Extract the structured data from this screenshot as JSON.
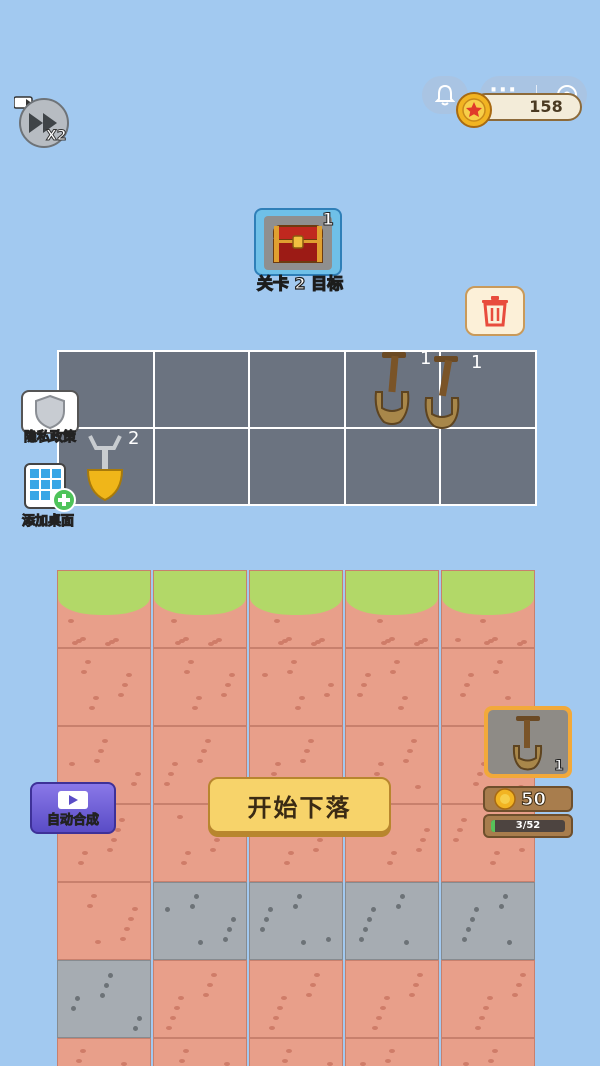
{
  "header": {
    "coins": "158",
    "speed_label": "X2"
  },
  "goal": {
    "chest_count": "1",
    "label": "关卡 2 目标"
  },
  "merge_grid": {
    "items": [
      {
        "row": 0,
        "col": 3,
        "item": "bronze-shovel",
        "count": "1"
      },
      {
        "row": 0,
        "col": 4,
        "item": "bronze-shovel",
        "count": "1"
      },
      {
        "row": 1,
        "col": 0,
        "item": "gold-shovel",
        "count": "2"
      }
    ]
  },
  "side_buttons": {
    "privacy": "隐私政策",
    "add_desktop": "添加桌面",
    "auto_merge": "自动合成"
  },
  "actions": {
    "start_drop": "开始下落"
  },
  "shop": {
    "shovel_count": "1",
    "price": "50",
    "progress_text": "3/52",
    "progress_value": 0.0577
  },
  "terrain": {
    "columns": [
      [
        "grass",
        "dirt",
        "dirt",
        "dirt",
        "dirt",
        "stone",
        "dirt"
      ],
      [
        "grass",
        "dirt",
        "dirt",
        "dirt",
        "stone",
        "dirt",
        "dirt"
      ],
      [
        "grass",
        "dirt",
        "dirt",
        "dirt",
        "stone",
        "dirt",
        "dirt"
      ],
      [
        "grass",
        "dirt",
        "dirt",
        "dirt",
        "stone",
        "dirt",
        "dirt"
      ],
      [
        "grass",
        "dirt",
        "dirt",
        "dirt",
        "stone",
        "dirt",
        "dirt"
      ]
    ]
  },
  "colors": {
    "background": "#a2c9f0",
    "grid_cell": "#6b7380",
    "dirt": "#e89f8a",
    "stone": "#a6acb2",
    "grass": "#b2d868",
    "start_button": "#f7d36a"
  }
}
